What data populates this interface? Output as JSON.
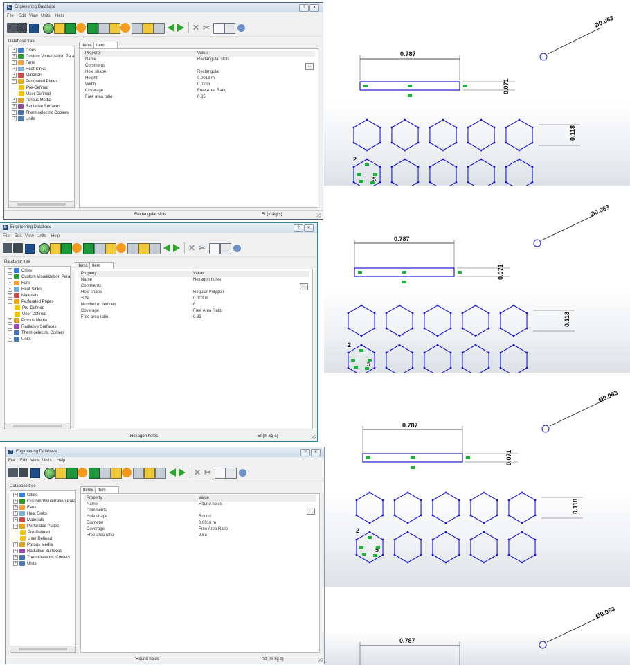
{
  "cad_panels": [
    {
      "width_label": "0.787",
      "height_label": "0.071",
      "pitch_label": "0.118",
      "diameter_label": "Ø0.063",
      "sketch_numbers": [
        "2",
        "5"
      ]
    },
    {
      "width_label": "0.787",
      "height_label": "0.071",
      "pitch_label": "0.118",
      "diameter_label": "Ø0.063",
      "sketch_numbers": [
        "2",
        "5"
      ]
    },
    {
      "width_label": "0.787",
      "height_label": "0.071",
      "pitch_label": "0.118",
      "diameter_label": "Ø0.063",
      "sketch_numbers": [
        "2",
        "5"
      ]
    },
    {
      "width_label": "0.787",
      "diameter_label": "Ø0.063"
    }
  ],
  "windows": [
    {
      "title": "Engineering Database",
      "menu": [
        "File",
        "Edit",
        "View",
        "Units",
        "Help"
      ],
      "tree_label": "Database tree",
      "tree": [
        "Cities",
        "Custom Visualization Para",
        "Fans",
        "Heat Sinks",
        "Materials",
        "Perforated Plates",
        "Pre-Defined",
        "User Defined",
        "Porous Media",
        "Radiative Surfaces",
        "Thermoelectric Coolers",
        "Units"
      ],
      "tabs": [
        "Items",
        "Item Properties"
      ],
      "props_header": [
        "Property",
        "Value"
      ],
      "props": [
        {
          "k": "Name",
          "v": "Rectangular slots"
        },
        {
          "k": "Comments",
          "v": ""
        },
        {
          "k": "Hole shape",
          "v": "Rectangular"
        },
        {
          "k": "Height",
          "v": "0.0018 m"
        },
        {
          "k": "Width",
          "v": "0.02 m"
        },
        {
          "k": "Coverage",
          "v": "Free Area Ratio"
        },
        {
          "k": "Free area ratio",
          "v": "0.35"
        }
      ],
      "status_item": "Rectangular slots",
      "status_units": "SI (m-kg-s)"
    },
    {
      "title": "Engineering Database",
      "menu": [
        "File",
        "Edit",
        "View",
        "Units",
        "Help"
      ],
      "tree_label": "Database tree",
      "tree": [
        "Cities",
        "Custom Visualization Para",
        "Fans",
        "Heat Sinks",
        "Materials",
        "Perforated Plates",
        "Pre-Defined",
        "User Defined",
        "Porous Media",
        "Radiative Surfaces",
        "Thermoelectric Coolers",
        "Units"
      ],
      "tabs": [
        "Items",
        "Item Properties"
      ],
      "props_header": [
        "Property",
        "Value"
      ],
      "props": [
        {
          "k": "Name",
          "v": "Hexagon holes"
        },
        {
          "k": "Comments",
          "v": ""
        },
        {
          "k": "Hole shape",
          "v": "Regular Polygon"
        },
        {
          "k": "Size",
          "v": "0.003 m"
        },
        {
          "k": "Number of vertices",
          "v": "6"
        },
        {
          "k": "Coverage",
          "v": "Free Area Ratio"
        },
        {
          "k": "Free area ratio",
          "v": "0.33"
        }
      ],
      "status_item": "Hexagon holes",
      "status_units": "SI (m-kg-s)"
    },
    {
      "title": "Engineering Database",
      "menu": [
        "File",
        "Edit",
        "View",
        "Units",
        "Help"
      ],
      "tree_label": "Database tree",
      "tree": [
        "Cities",
        "Custom Visualization Para",
        "Fans",
        "Heat Sinks",
        "Materials",
        "Perforated Plates",
        "Pre-Defined",
        "User Defined",
        "Porous Media",
        "Radiative Surfaces",
        "Thermoelectric Coolers",
        "Units"
      ],
      "tabs": [
        "Items",
        "Item Properties"
      ],
      "props_header": [
        "Property",
        "Value"
      ],
      "props": [
        {
          "k": "Name",
          "v": "Round holes"
        },
        {
          "k": "Comments",
          "v": ""
        },
        {
          "k": "Hole shape",
          "v": "Round"
        },
        {
          "k": "Diameter",
          "v": "0.0016 m"
        },
        {
          "k": "Coverage",
          "v": "Free Area Ratio"
        },
        {
          "k": "Free area ratio",
          "v": "0.53"
        }
      ],
      "status_item": "Round holes",
      "status_units": "SI (m-kg-s)"
    }
  ],
  "colors": {
    "sketch_blue": "#1a1ad6",
    "constraint_green": "#19b33a",
    "title_bar": "#cfdbe9",
    "teal_border": "#2b8a8a"
  }
}
